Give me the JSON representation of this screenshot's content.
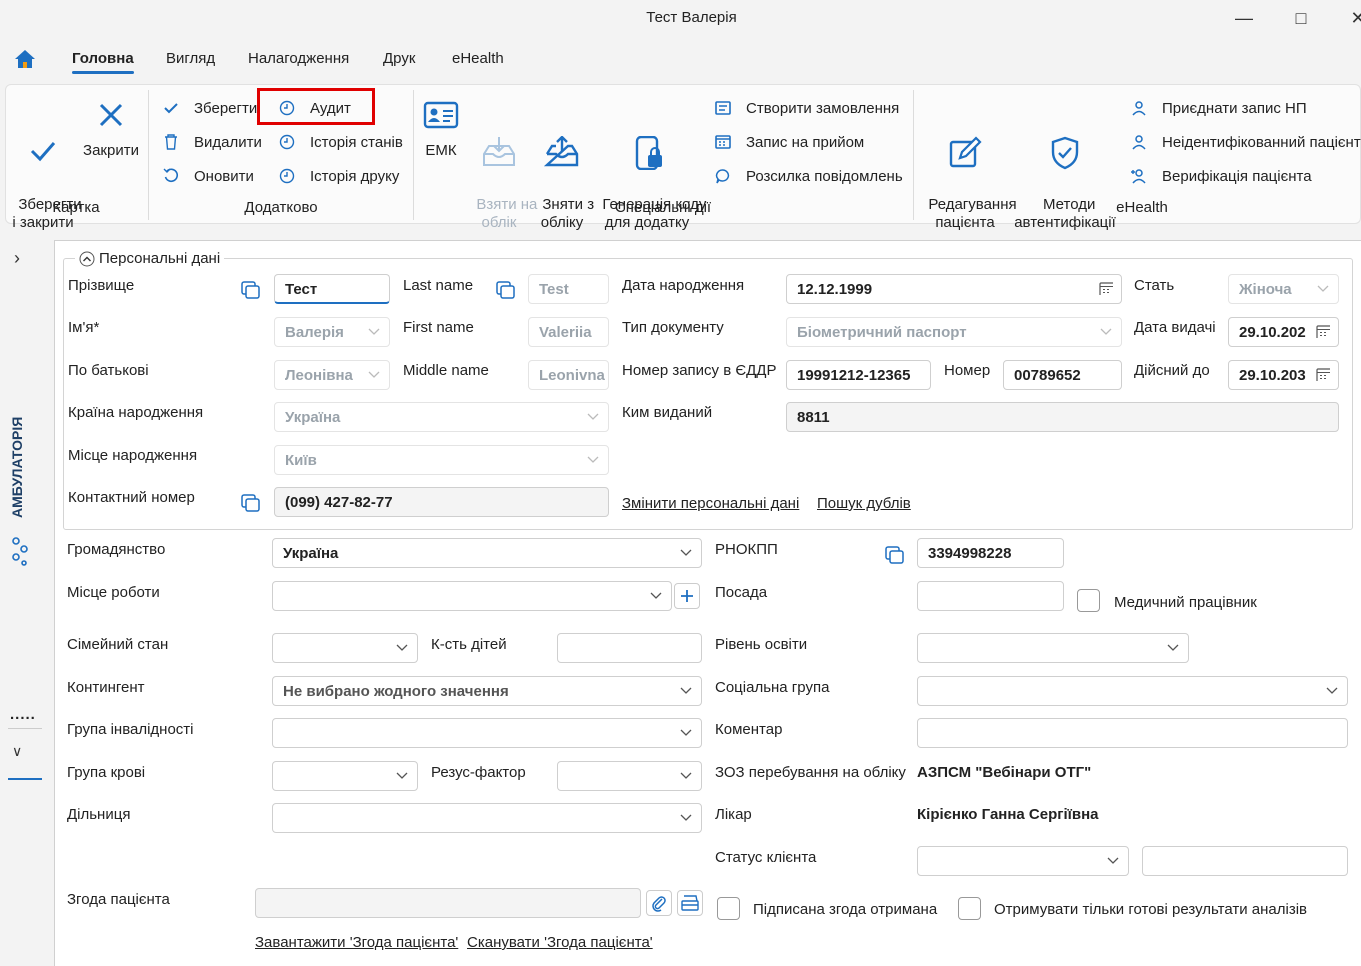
{
  "window": {
    "title": "Тест Валерія"
  },
  "menu": {
    "home": "home",
    "tabs": [
      "Головна",
      "Вигляд",
      "Налагодження",
      "Друк",
      "eHealth"
    ]
  },
  "ribbon": {
    "card": {
      "save_close": "Зберегти\nі закрити",
      "close": "Закрити",
      "group": "Картка"
    },
    "extra": {
      "save": "Зберегти",
      "delete": "Видалити",
      "refresh": "Оновити",
      "audit": "Аудит",
      "state_history": "Історія станів",
      "print_history": "Історія друку",
      "group": "Додатково"
    },
    "special": {
      "emk": "ЕМК",
      "take": "Взяти на\nоблік",
      "remove": "Зняти з\nобліку",
      "gen_code": "Генерація коду\nдля додатку",
      "create_order": "Створити замовлення",
      "appointment": "Запис на прийом",
      "mailing": "Розсилка повідомлень",
      "group": "Спеціальні дії"
    },
    "ehealth": {
      "edit_patient": "Редагування\nпацієнта",
      "auth_methods": "Методи\nавтентифікації",
      "attach_np": "Приєднати запис НП",
      "unidentified": "Неідентифікованний пацієнт",
      "verify": "Верифікація пацієнта",
      "group": "eHealth"
    }
  },
  "sidebar": {
    "section": "АМБУЛАТОРІЯ",
    "dots": "....."
  },
  "personal": {
    "title": "Персональні дані",
    "surname_label": "Прізвище",
    "surname": "Тест",
    "lastname_label": "Last name",
    "lastname": "Test",
    "dob_label": "Дата народження",
    "dob": "12.12.1999",
    "sex_label": "Стать",
    "sex": "Жіноча",
    "name_label": "Ім'я*",
    "name": "Валерія",
    "firstname_label": "First name",
    "firstname": "Valeriia",
    "doctype_label": "Тип документу",
    "doctype": "Біометричний паспорт",
    "issue_label": "Дата видачі",
    "issue": "29.10.202",
    "patronymic_label": "По батькові",
    "patronymic": "Леонівна",
    "middlename_label": "Middle name",
    "middlename": "Leonivna",
    "eddr_label": "Номер запису в ЄДДР",
    "eddr": "19991212-12365",
    "number_label": "Номер",
    "number": "00789652",
    "valid_label": "Дійсний до",
    "valid": "29.10.203",
    "country_label": "Країна народження",
    "country": "Україна",
    "issuer_label": "Ким виданий",
    "issuer": "8811",
    "place_label": "Місце народження",
    "place": "Київ",
    "phone_label": "Контактний номер",
    "phone": "(099) 427-82-77",
    "change_link": "Змінити персональні дані",
    "dupes_link": "Пошук дублів"
  },
  "form": {
    "citizenship_label": "Громадянство",
    "citizenship": "Україна",
    "rnokpp_label": "РНОКПП",
    "rnokpp": "3394998228",
    "work_label": "Місце роботи",
    "position_label": "Посада",
    "medworker_label": "Медичний працівник",
    "marital_label": "Сімейний стан",
    "children_label": "К-сть дітей",
    "education_label": "Рівень освіти",
    "contingent_label": "Контингент",
    "contingent": "Не вибрано жодного значення",
    "social_label": "Соціальна група",
    "disability_label": "Група інвалідності",
    "comment_label": "Коментар",
    "blood_label": "Група крові",
    "rhesus_label": "Резус-фактор",
    "zoz_label": "ЗОЗ перебування на обліку",
    "zoz": "АЗПСМ \"Вебінари ОТГ\"",
    "district_label": "Дільниця",
    "doctor_label": "Лікар",
    "doctor": "Кірієнко Ганна Сергіївна",
    "status_label": "Статус клієнта",
    "consent_label": "Згода пацієнта",
    "signed_label": "Підписана згода отримана",
    "ready_only_label": "Отримувати тільки готові результати аналізів",
    "upload_link": "Завантажити 'Згода пацієнта'",
    "scan_link": "Сканувати 'Згода пацієнта'"
  },
  "colors": {
    "accent": "#1e6fc1",
    "highlight": "#e00000"
  }
}
